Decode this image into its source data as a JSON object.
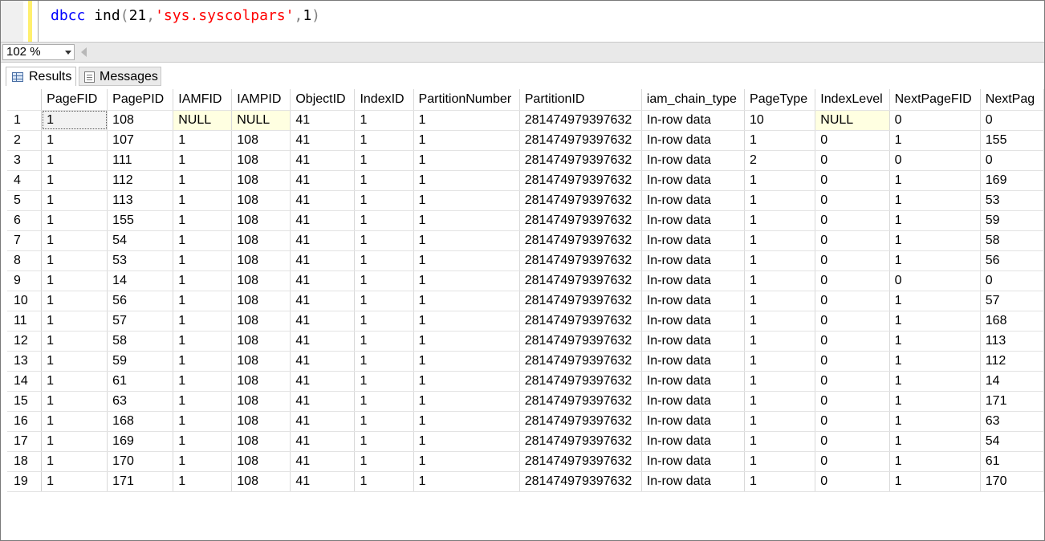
{
  "editor": {
    "keyword": "dbcc",
    "function": "ind",
    "open_paren": "(",
    "arg1": "21",
    "comma1": ",",
    "arg2": "'sys.syscolpars'",
    "comma2": ",",
    "arg3": "1",
    "close_paren": ")"
  },
  "zoom": {
    "value": "102 %"
  },
  "tabs": {
    "results": "Results",
    "messages": "Messages"
  },
  "grid": {
    "columns": [
      "",
      "PageFID",
      "PagePID",
      "IAMFID",
      "IAMPID",
      "ObjectID",
      "IndexID",
      "PartitionNumber",
      "PartitionID",
      "iam_chain_type",
      "PageType",
      "IndexLevel",
      "NextPageFID",
      "NextPag"
    ],
    "rows": [
      [
        "1",
        "1",
        "108",
        "NULL",
        "NULL",
        "41",
        "1",
        "1",
        "281474979397632",
        "In-row data",
        "10",
        "NULL",
        "0",
        "0"
      ],
      [
        "2",
        "1",
        "107",
        "1",
        "108",
        "41",
        "1",
        "1",
        "281474979397632",
        "In-row data",
        "1",
        "0",
        "1",
        "155"
      ],
      [
        "3",
        "1",
        "111",
        "1",
        "108",
        "41",
        "1",
        "1",
        "281474979397632",
        "In-row data",
        "2",
        "0",
        "0",
        "0"
      ],
      [
        "4",
        "1",
        "112",
        "1",
        "108",
        "41",
        "1",
        "1",
        "281474979397632",
        "In-row data",
        "1",
        "0",
        "1",
        "169"
      ],
      [
        "5",
        "1",
        "113",
        "1",
        "108",
        "41",
        "1",
        "1",
        "281474979397632",
        "In-row data",
        "1",
        "0",
        "1",
        "53"
      ],
      [
        "6",
        "1",
        "155",
        "1",
        "108",
        "41",
        "1",
        "1",
        "281474979397632",
        "In-row data",
        "1",
        "0",
        "1",
        "59"
      ],
      [
        "7",
        "1",
        "54",
        "1",
        "108",
        "41",
        "1",
        "1",
        "281474979397632",
        "In-row data",
        "1",
        "0",
        "1",
        "58"
      ],
      [
        "8",
        "1",
        "53",
        "1",
        "108",
        "41",
        "1",
        "1",
        "281474979397632",
        "In-row data",
        "1",
        "0",
        "1",
        "56"
      ],
      [
        "9",
        "1",
        "14",
        "1",
        "108",
        "41",
        "1",
        "1",
        "281474979397632",
        "In-row data",
        "1",
        "0",
        "0",
        "0"
      ],
      [
        "10",
        "1",
        "56",
        "1",
        "108",
        "41",
        "1",
        "1",
        "281474979397632",
        "In-row data",
        "1",
        "0",
        "1",
        "57"
      ],
      [
        "11",
        "1",
        "57",
        "1",
        "108",
        "41",
        "1",
        "1",
        "281474979397632",
        "In-row data",
        "1",
        "0",
        "1",
        "168"
      ],
      [
        "12",
        "1",
        "58",
        "1",
        "108",
        "41",
        "1",
        "1",
        "281474979397632",
        "In-row data",
        "1",
        "0",
        "1",
        "113"
      ],
      [
        "13",
        "1",
        "59",
        "1",
        "108",
        "41",
        "1",
        "1",
        "281474979397632",
        "In-row data",
        "1",
        "0",
        "1",
        "112"
      ],
      [
        "14",
        "1",
        "61",
        "1",
        "108",
        "41",
        "1",
        "1",
        "281474979397632",
        "In-row data",
        "1",
        "0",
        "1",
        "14"
      ],
      [
        "15",
        "1",
        "63",
        "1",
        "108",
        "41",
        "1",
        "1",
        "281474979397632",
        "In-row data",
        "1",
        "0",
        "1",
        "171"
      ],
      [
        "16",
        "1",
        "168",
        "1",
        "108",
        "41",
        "1",
        "1",
        "281474979397632",
        "In-row data",
        "1",
        "0",
        "1",
        "63"
      ],
      [
        "17",
        "1",
        "169",
        "1",
        "108",
        "41",
        "1",
        "1",
        "281474979397632",
        "In-row data",
        "1",
        "0",
        "1",
        "54"
      ],
      [
        "18",
        "1",
        "170",
        "1",
        "108",
        "41",
        "1",
        "1",
        "281474979397632",
        "In-row data",
        "1",
        "0",
        "1",
        "61"
      ],
      [
        "19",
        "1",
        "171",
        "1",
        "108",
        "41",
        "1",
        "1",
        "281474979397632",
        "In-row data",
        "1",
        "0",
        "1",
        "170"
      ]
    ]
  }
}
